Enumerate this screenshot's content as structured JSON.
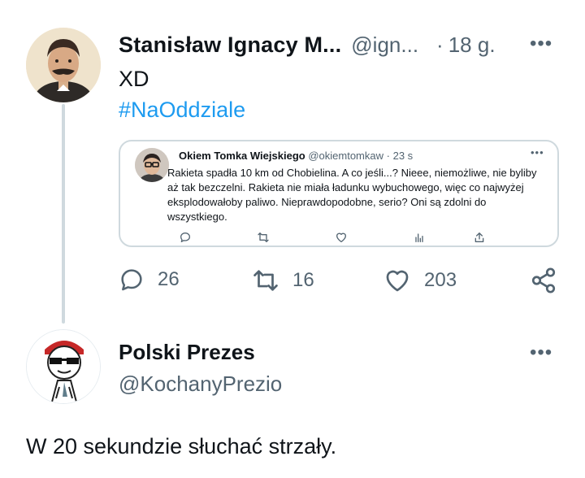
{
  "tweet": {
    "author_name": "Stanisław Ignacy M...",
    "author_handle": "@ign...",
    "dot": "·",
    "time": "18 g.",
    "more": "•••",
    "text": "XD",
    "hashtag": "#NaOddziale"
  },
  "quote": {
    "author_name": "Okiem Tomka Wiejskiego",
    "author_handle": "@okiemtomkaw",
    "dot": "·",
    "time": "23 s",
    "more": "•••",
    "text": "Rakieta spadła 10 km od Chobielina. A co jeśli...? Nieee, niemożliwe, nie byliby aż tak bezczelni. Rakieta nie miała ładunku wybuchowego, więc co najwyżej eksplodowałoby paliwo. Nieprawdopodobne, serio? Oni są zdolni do wszystkiego.",
    "actions": [
      "reply-icon",
      "retweet-icon",
      "like-icon",
      "views-icon",
      "share-icon"
    ]
  },
  "actions": {
    "replies": "26",
    "retweets": "16",
    "likes": "203",
    "icons": [
      "reply-icon",
      "retweet-icon",
      "like-icon",
      "share-icon"
    ]
  },
  "reply": {
    "author_name": "Polski Prezes",
    "author_handle": "@KochanyPrezio",
    "more": "•••",
    "text": "W 20 sekundzie słuchać strzały."
  },
  "colors": {
    "accent": "#1d9bf0",
    "secondary_text": "#536471",
    "border": "#cfd9de"
  }
}
